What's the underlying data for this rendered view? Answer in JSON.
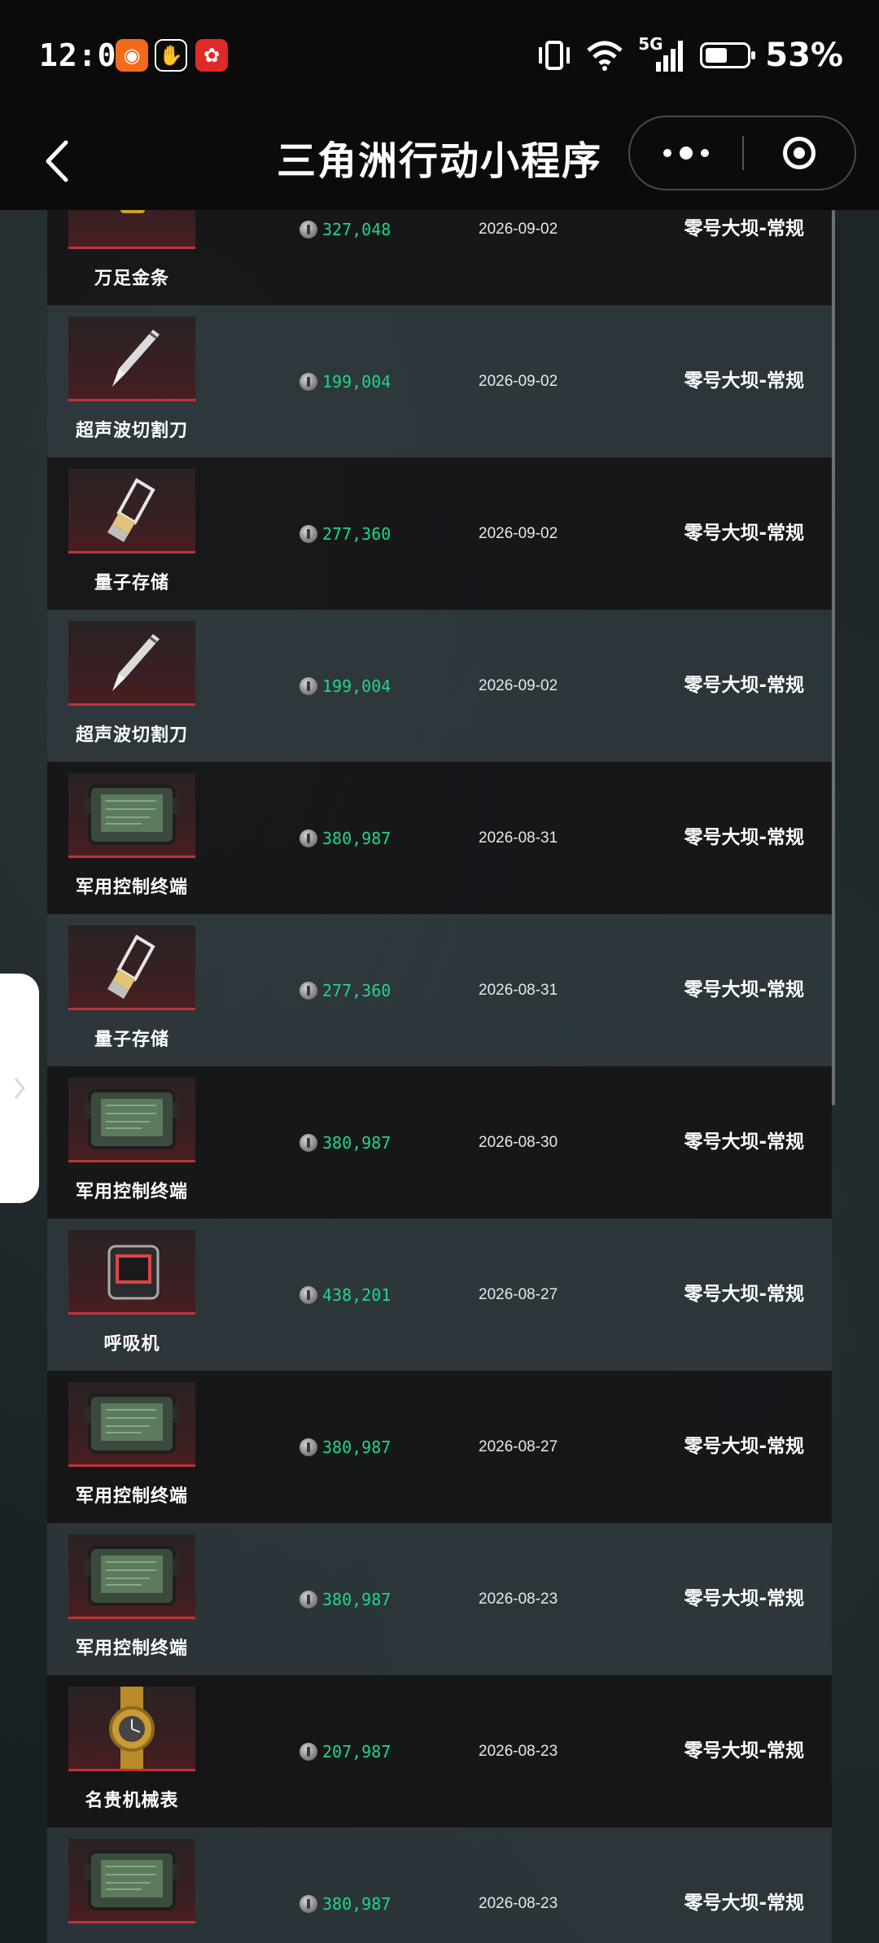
{
  "status_bar": {
    "time": "12:01",
    "network": "5G",
    "battery_percent": "53%",
    "battery_level": 0.53
  },
  "nav": {
    "title": "三角洲行动小程序"
  },
  "colors": {
    "price_green": "#1fd68a",
    "thumb_border_red": "#c0333a"
  },
  "records": [
    {
      "item": "万足金条",
      "icon": "gold-bar-icon",
      "price": "327,048",
      "date": "2026-09-02",
      "map": "零号大坝-常规"
    },
    {
      "item": "超声波切割刀",
      "icon": "scalpel-icon",
      "price": "199,004",
      "date": "2026-09-02",
      "map": "零号大坝-常规"
    },
    {
      "item": "量子存储",
      "icon": "usb-drive-icon",
      "price": "277,360",
      "date": "2026-09-02",
      "map": "零号大坝-常规"
    },
    {
      "item": "超声波切割刀",
      "icon": "scalpel-icon",
      "price": "199,004",
      "date": "2026-09-02",
      "map": "零号大坝-常规"
    },
    {
      "item": "军用控制终端",
      "icon": "control-terminal-icon",
      "price": "380,987",
      "date": "2026-08-31",
      "map": "零号大坝-常规"
    },
    {
      "item": "量子存储",
      "icon": "usb-drive-icon",
      "price": "277,360",
      "date": "2026-08-31",
      "map": "零号大坝-常规"
    },
    {
      "item": "军用控制终端",
      "icon": "control-terminal-icon",
      "price": "380,987",
      "date": "2026-08-30",
      "map": "零号大坝-常规"
    },
    {
      "item": "呼吸机",
      "icon": "respirator-icon",
      "price": "438,201",
      "date": "2026-08-27",
      "map": "零号大坝-常规"
    },
    {
      "item": "军用控制终端",
      "icon": "control-terminal-icon",
      "price": "380,987",
      "date": "2026-08-27",
      "map": "零号大坝-常规"
    },
    {
      "item": "军用控制终端",
      "icon": "control-terminal-icon",
      "price": "380,987",
      "date": "2026-08-23",
      "map": "零号大坝-常规"
    },
    {
      "item": "名贵机械表",
      "icon": "luxury-watch-icon",
      "price": "207,987",
      "date": "2026-08-23",
      "map": "零号大坝-常规"
    },
    {
      "item": "",
      "icon": "control-terminal-icon",
      "price": "380,987",
      "date": "2026-08-23",
      "map": "零号大坝-常规"
    }
  ]
}
